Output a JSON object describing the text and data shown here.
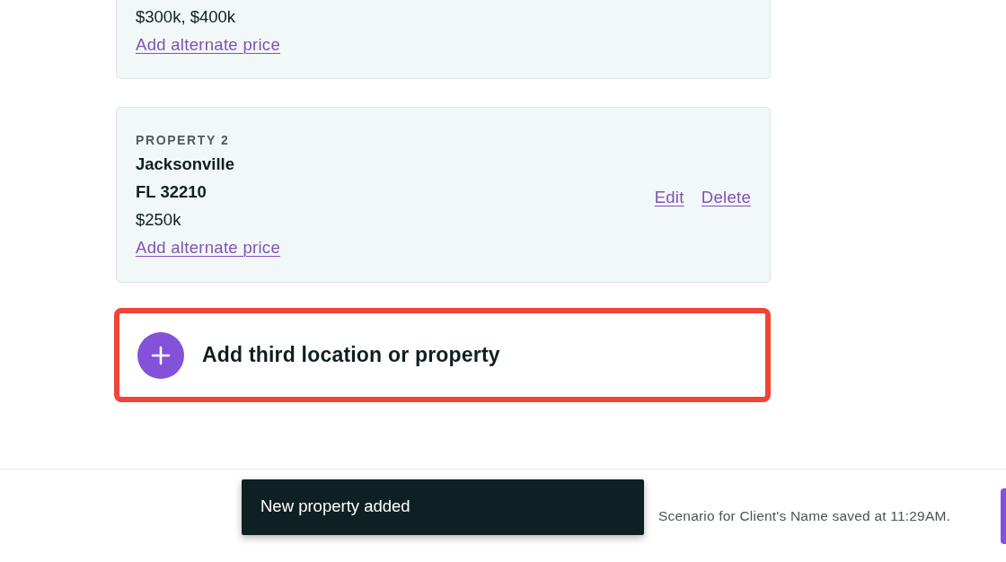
{
  "properties": [
    {
      "price": "$300k, $400k",
      "alternate_price_link": "Add alternate price"
    },
    {
      "label": "PROPERTY 2",
      "city": "Jacksonville",
      "region": "FL 32210",
      "price": "$250k",
      "alternate_price_link": "Add alternate price",
      "actions": [
        "Edit",
        "Delete"
      ]
    }
  ],
  "add_property": {
    "label": "Add third location or property",
    "highlighted": true
  },
  "footer": {
    "toast": {
      "message": "New property added"
    },
    "save_status": "Scenario for Client's Name saved at 11:29AM."
  }
}
